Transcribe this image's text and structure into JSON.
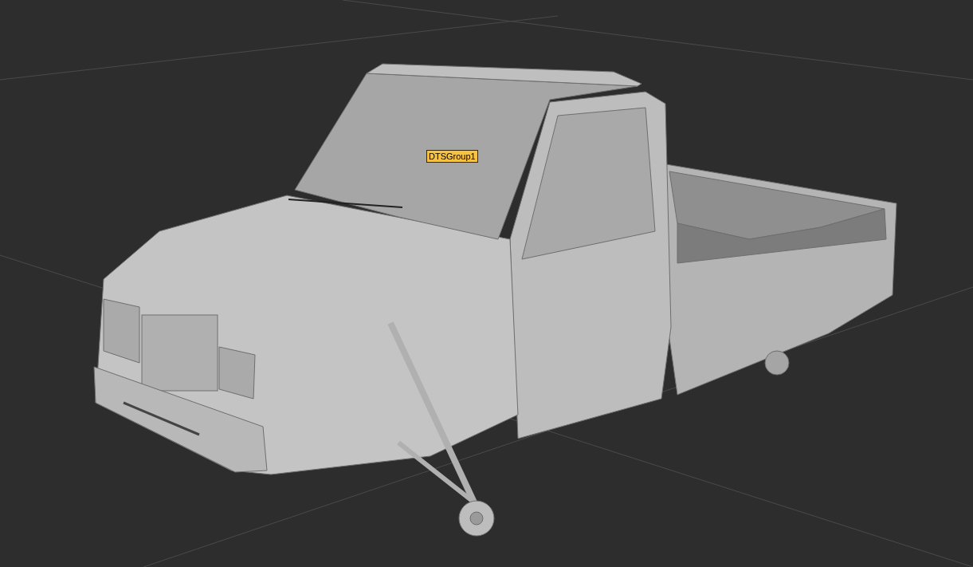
{
  "viewport": {
    "object_label": "DTSGroup1"
  }
}
